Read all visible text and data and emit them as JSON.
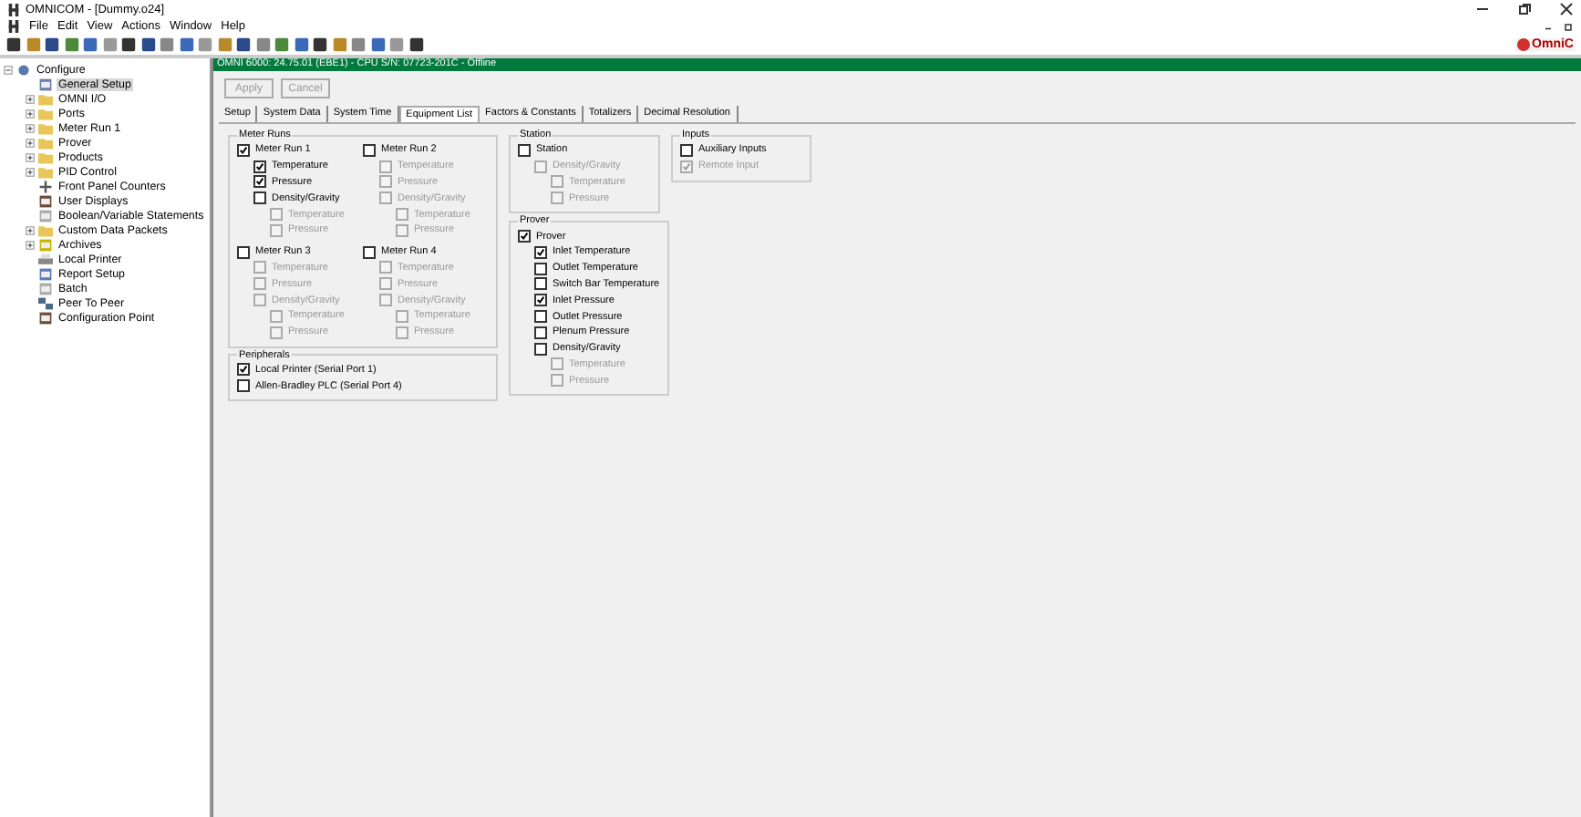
{
  "window": {
    "title": "OMNICOM - [Dummy.o24]"
  },
  "menu": [
    "File",
    "Edit",
    "View",
    "Actions",
    "Window",
    "Help"
  ],
  "logo": {
    "text": "OmniC"
  },
  "tree": [
    {
      "label": "Configure",
      "kind": "config",
      "expanded": true,
      "selected": false,
      "children": [
        {
          "label": "General Setup",
          "kind": "setup",
          "selected": true
        },
        {
          "label": "OMNI I/O",
          "kind": "folder",
          "expanded": false,
          "selected": false
        },
        {
          "label": "Ports",
          "kind": "folder",
          "expanded": false,
          "selected": false
        },
        {
          "label": "Meter Run 1",
          "kind": "folder",
          "expanded": false,
          "selected": false
        },
        {
          "label": "Prover",
          "kind": "folder",
          "expanded": false,
          "selected": false
        },
        {
          "label": "Products",
          "kind": "folder",
          "expanded": false,
          "selected": false
        },
        {
          "label": "PID Control",
          "kind": "folder",
          "expanded": false,
          "selected": false
        },
        {
          "label": "Front Panel Counters",
          "kind": "counter",
          "selected": false
        },
        {
          "label": "User Displays",
          "kind": "display",
          "selected": false
        },
        {
          "label": "Boolean/Variable Statements",
          "kind": "statements",
          "selected": false
        },
        {
          "label": "Custom Data Packets",
          "kind": "folder",
          "expanded": false,
          "selected": false
        },
        {
          "label": "Archives",
          "kind": "archive",
          "expanded": false,
          "selected": false
        },
        {
          "label": "Local Printer",
          "kind": "printer",
          "selected": false
        },
        {
          "label": "Report Setup",
          "kind": "report",
          "selected": false
        },
        {
          "label": "Batch",
          "kind": "statements",
          "selected": false
        },
        {
          "label": "Peer To Peer",
          "kind": "peer",
          "selected": false
        },
        {
          "label": "Configuration Point",
          "kind": "display",
          "selected": false
        }
      ]
    }
  ],
  "header": "OMNI 6000: 24.75.01 (EBE1) - CPU S/N: 07723-201C - Offline",
  "buttons": [
    {
      "label": "Apply",
      "disabled": true
    },
    {
      "label": "Cancel",
      "disabled": true
    }
  ],
  "tabs": [
    {
      "label": "Setup",
      "selected": false
    },
    {
      "label": "System Data",
      "selected": false
    },
    {
      "label": "System Time",
      "selected": false
    },
    {
      "label": "Equipment List",
      "selected": true
    },
    {
      "label": "Factors & Constants",
      "selected": false
    },
    {
      "label": "Totalizers",
      "selected": false
    },
    {
      "label": "Decimal Resolution",
      "selected": false
    }
  ],
  "meter_runs": {
    "title": "Meter Runs",
    "runs": [
      {
        "label": "Meter Run 1",
        "checked": true,
        "disabled": false,
        "children": [
          {
            "label": "Temperature",
            "checked": true,
            "disabled": false
          },
          {
            "label": "Pressure",
            "checked": true,
            "disabled": false
          },
          {
            "label": "Density/Gravity",
            "checked": false,
            "disabled": false,
            "children": [
              {
                "label": "Temperature",
                "checked": false,
                "disabled": true
              },
              {
                "label": "Pressure",
                "checked": false,
                "disabled": true
              }
            ]
          }
        ]
      },
      {
        "label": "Meter Run 2",
        "checked": false,
        "disabled": false,
        "children": [
          {
            "label": "Temperature",
            "checked": false,
            "disabled": true
          },
          {
            "label": "Pressure",
            "checked": false,
            "disabled": true
          },
          {
            "label": "Density/Gravity",
            "checked": false,
            "disabled": true,
            "children": [
              {
                "label": "Temperature",
                "checked": false,
                "disabled": true
              },
              {
                "label": "Pressure",
                "checked": false,
                "disabled": true
              }
            ]
          }
        ]
      },
      {
        "label": "Meter Run 3",
        "checked": false,
        "disabled": false,
        "children": [
          {
            "label": "Temperature",
            "checked": false,
            "disabled": true
          },
          {
            "label": "Pressure",
            "checked": false,
            "disabled": true
          },
          {
            "label": "Density/Gravity",
            "checked": false,
            "disabled": true,
            "children": [
              {
                "label": "Temperature",
                "checked": false,
                "disabled": true
              },
              {
                "label": "Pressure",
                "checked": false,
                "disabled": true
              }
            ]
          }
        ]
      },
      {
        "label": "Meter Run 4",
        "checked": false,
        "disabled": false,
        "children": [
          {
            "label": "Temperature",
            "checked": false,
            "disabled": true
          },
          {
            "label": "Pressure",
            "checked": false,
            "disabled": true
          },
          {
            "label": "Density/Gravity",
            "checked": false,
            "disabled": true,
            "children": [
              {
                "label": "Temperature",
                "checked": false,
                "disabled": true
              },
              {
                "label": "Pressure",
                "checked": false,
                "disabled": true
              }
            ]
          }
        ]
      }
    ]
  },
  "peripherals": {
    "title": "Peripherals",
    "items": [
      {
        "label": "Local Printer (Serial Port 1)",
        "checked": true,
        "disabled": false
      },
      {
        "label": "Allen-Bradley PLC (Serial Port 4)",
        "checked": false,
        "disabled": false
      }
    ]
  },
  "station": {
    "title": "Station",
    "items": [
      {
        "label": "Station",
        "checked": false,
        "disabled": false,
        "children": [
          {
            "label": "Density/Gravity",
            "checked": false,
            "disabled": true,
            "children": [
              {
                "label": "Temperature",
                "checked": false,
                "disabled": true
              },
              {
                "label": "Pressure",
                "checked": false,
                "disabled": true
              }
            ]
          }
        ]
      }
    ]
  },
  "prover": {
    "title": "Prover",
    "items": [
      {
        "label": "Prover",
        "checked": true,
        "disabled": false,
        "children": [
          {
            "label": "Inlet Temperature",
            "checked": true,
            "disabled": false
          },
          {
            "label": "Outlet Temperature",
            "checked": false,
            "disabled": false
          },
          {
            "label": "Switch Bar Temperature",
            "checked": false,
            "disabled": false
          },
          {
            "label": "Inlet Pressure",
            "checked": true,
            "disabled": false
          },
          {
            "label": "Outlet Pressure",
            "checked": false,
            "disabled": false
          },
          {
            "label": "Plenum Pressure",
            "checked": false,
            "disabled": false
          },
          {
            "label": "Density/Gravity",
            "checked": false,
            "disabled": false,
            "children": [
              {
                "label": "Temperature",
                "checked": false,
                "disabled": true
              },
              {
                "label": "Pressure",
                "checked": false,
                "disabled": true
              }
            ]
          }
        ]
      }
    ]
  },
  "inputs": {
    "title": "Inputs",
    "items": [
      {
        "label": "Auxiliary Inputs",
        "checked": false,
        "disabled": false
      },
      {
        "label": "Remote Input",
        "checked": true,
        "disabled": true
      }
    ]
  }
}
